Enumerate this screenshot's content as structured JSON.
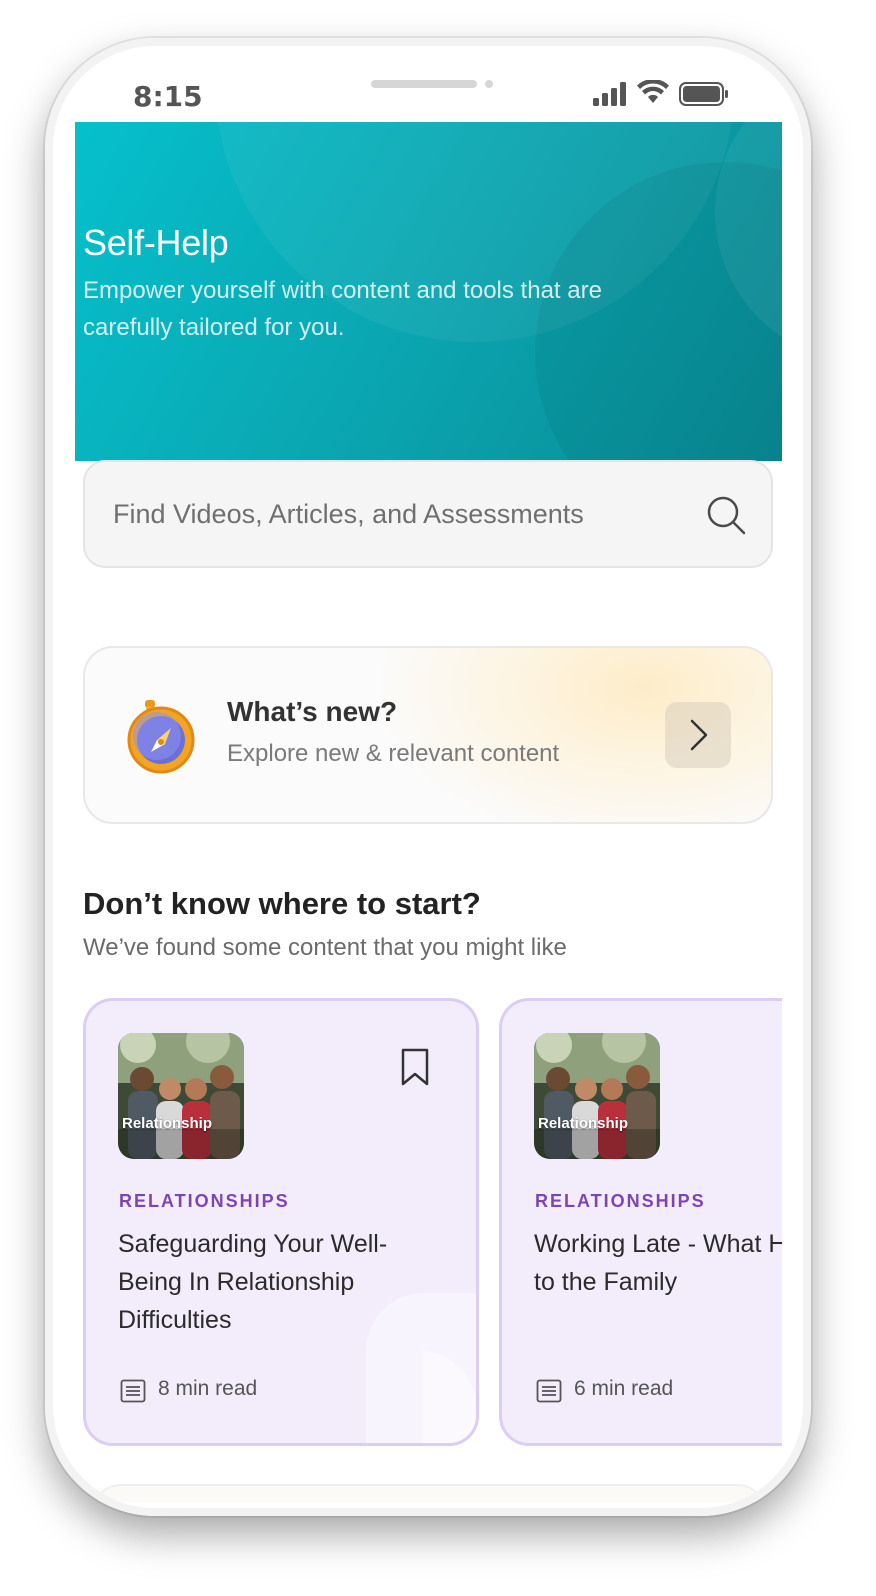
{
  "status_bar": {
    "time": "8:15",
    "icons": [
      "signal-icon",
      "wifi-icon",
      "battery-icon"
    ]
  },
  "hero": {
    "title": "Self-Help",
    "subtitle": "Empower yourself with content and tools that are carefully tailored for you.",
    "gradient_colors": [
      "#05c0cc",
      "#098a94"
    ]
  },
  "search": {
    "placeholder": "Find Videos, Articles, and Assessments",
    "value": ""
  },
  "whats_new": {
    "title": "What’s new?",
    "subtitle": "Explore new & relevant content",
    "icon": "compass-icon",
    "action_icon": "chevron-right-icon"
  },
  "recommendations": {
    "title": "Don’t know where to start?",
    "subtitle": "We’ve found some content that you might like",
    "cards": [
      {
        "thumbnail_label": "Relationship",
        "category": "RELATIONSHIPS",
        "title": "Safeguarding Your Well-Being In Relationship Difficulties",
        "meta": "8 min read",
        "bookmark_visible": true
      },
      {
        "thumbnail_label": "Relationship",
        "category": "RELATIONSHIPS",
        "title": "Working Late - What Happens to the Family",
        "meta": "6 min read",
        "bookmark_visible": false
      }
    ]
  },
  "colors": {
    "accent_teal": "#0aa8b3",
    "category_purple": "#7b45b8",
    "card_background": "#f2ecfb",
    "card_border": "#dccdf2"
  }
}
